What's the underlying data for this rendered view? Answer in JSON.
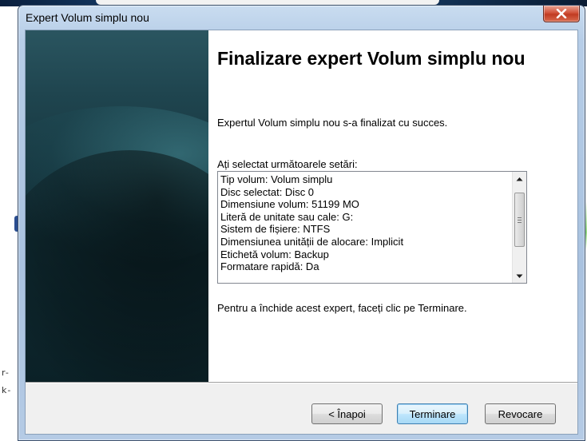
{
  "window": {
    "title": "Expert Volum simplu nou",
    "close_icon": "close-icon"
  },
  "background": {
    "left_text_1": "r-",
    "left_text_2": "k-"
  },
  "page": {
    "heading": "Finalizare expert Volum simplu nou",
    "success_text": "Expertul Volum simplu nou s-a finalizat cu succes.",
    "settings_label": "Ați selectat următoarele setări:",
    "settings": [
      "Tip volum: Volum simplu",
      "Disc selectat: Disc 0",
      "Dimensiune volum: 51199 MO",
      "Literă de unitate sau cale: G:",
      "Sistem de fișiere: NTFS",
      "Dimensiunea unității de alocare: Implicit",
      "Etichetă volum: Backup",
      "Formatare rapidă: Da"
    ],
    "close_hint": "Pentru a închide acest expert, faceți clic pe Terminare."
  },
  "buttons": {
    "back": "< Înapoi",
    "finish": "Terminare",
    "cancel": "Revocare"
  },
  "colors": {
    "close_button": "#c13b22",
    "side_panel": "#173740",
    "default_button_border": "#3c7fb1"
  }
}
